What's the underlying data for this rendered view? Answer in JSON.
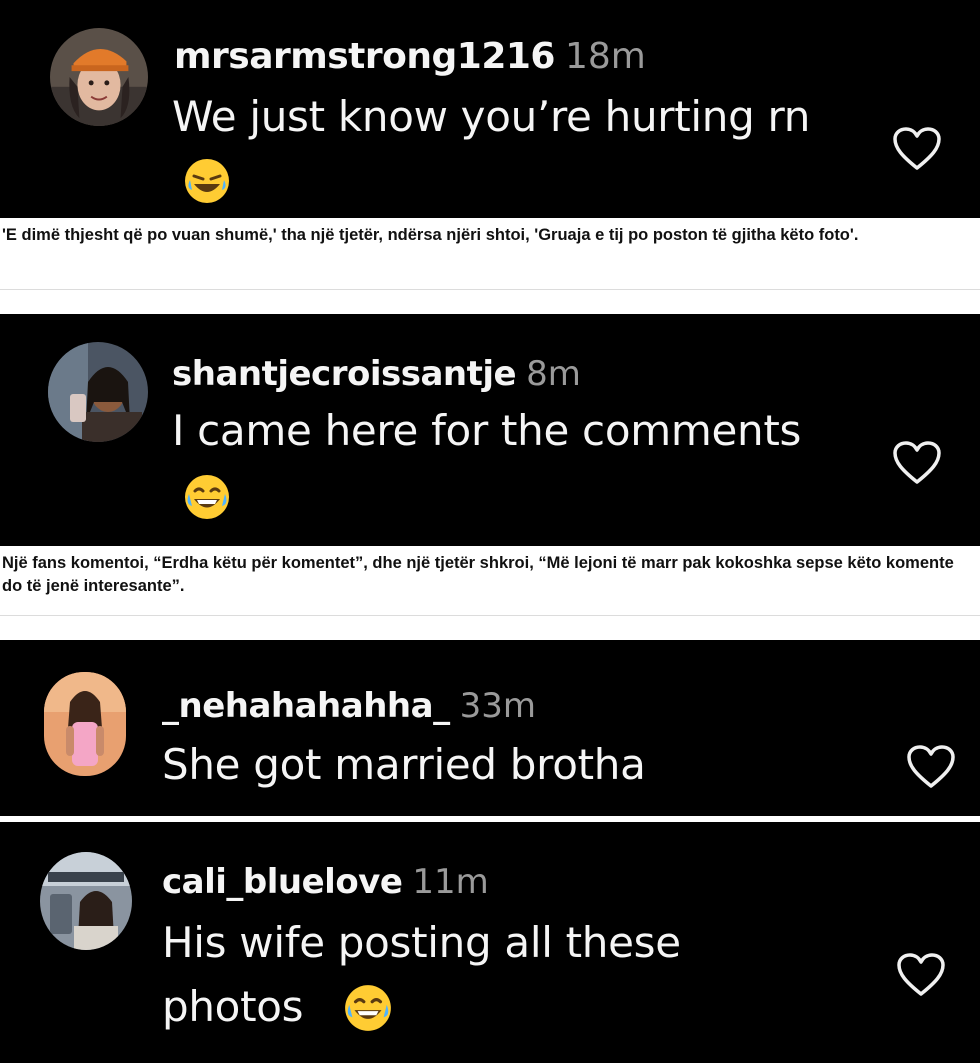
{
  "comments": [
    {
      "username": "mrsarmstrong1216",
      "time": "18m",
      "text": "We just know you’re hurting rn",
      "emoji": "😂"
    },
    {
      "username": "shantjecroissantje",
      "time": "8m",
      "text": "I came here for the comments",
      "emoji": "😂"
    },
    {
      "username": "_nehahahahha_",
      "time": "33m",
      "text": "She got married brotha"
    },
    {
      "username": "cali_bluelove",
      "time": "11m",
      "text_line1": "His wife posting all these",
      "text_line2": "photos",
      "emoji": "😂"
    }
  ],
  "captions": [
    "'E dimë thjesht që po vuan shumë,' tha një tjetër, ndërsa njëri shtoi, 'Gruaja e tij po poston të gjitha këto foto'.",
    "Një fans komentoi, “Erdha këtu për komentet”, dhe një tjetër shkroi, “Më lejoni të marr pak kokoshka sepse këto komente do të jenë interesante”."
  ],
  "icons": {
    "like": "heart-outline-icon",
    "reaction": "laughing-emoji-icon"
  },
  "colors": {
    "panel_bg": "#000000",
    "text": "#f5f5f5",
    "time": "#9a9a9a",
    "caption_bg": "#ffffff",
    "caption_text": "#111111"
  }
}
